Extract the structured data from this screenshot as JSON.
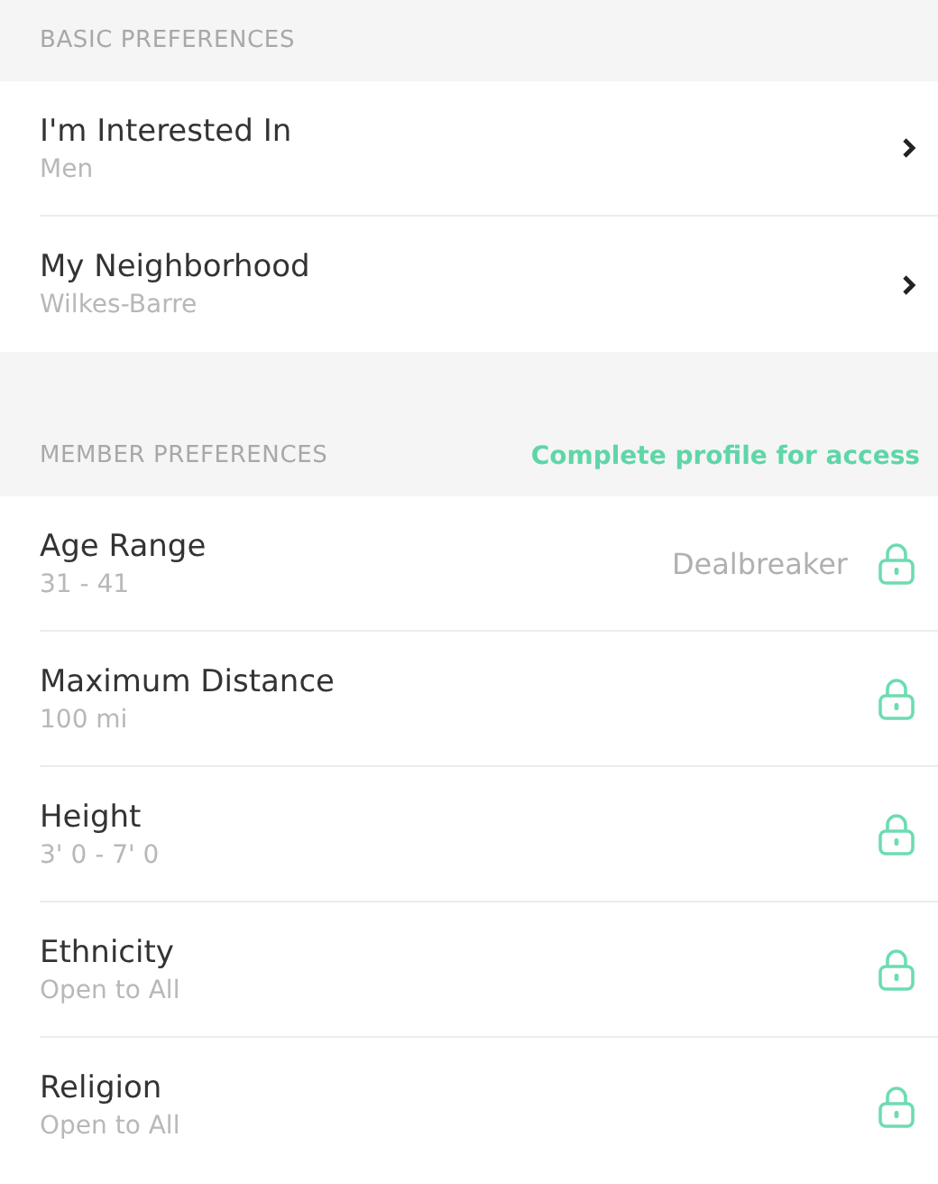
{
  "sections": [
    {
      "title": "BASIC PREFERENCES",
      "rows": [
        {
          "kind": "chevron",
          "label": "I'm Interested In",
          "value": "Men"
        },
        {
          "kind": "chevron",
          "label": "My Neighborhood",
          "value": "Wilkes-Barre"
        }
      ]
    },
    {
      "title": "MEMBER PREFERENCES",
      "action": "Complete profile for access",
      "rows": [
        {
          "kind": "locked",
          "label": "Age Range",
          "value": "31 - 41",
          "note": "Dealbreaker"
        },
        {
          "kind": "locked",
          "label": "Maximum Distance",
          "value": "100 mi"
        },
        {
          "kind": "locked",
          "label": "Height",
          "value": "3' 0 - 7' 0"
        },
        {
          "kind": "locked",
          "label": "Ethnicity",
          "value": "Open to All"
        },
        {
          "kind": "locked",
          "label": "Religion",
          "value": "Open to All"
        }
      ]
    }
  ]
}
